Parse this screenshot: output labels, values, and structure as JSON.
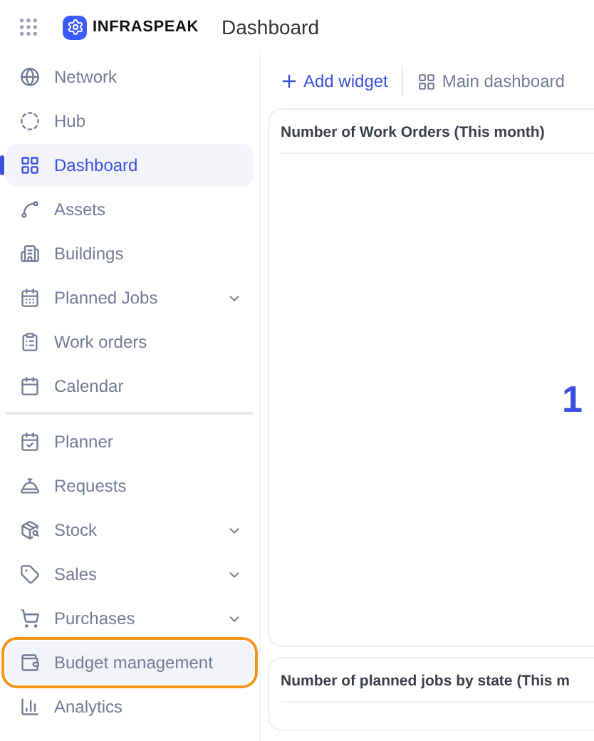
{
  "header": {
    "brand": "INFRASPEAK",
    "title": "Dashboard"
  },
  "sidebar": {
    "groups": [
      [
        {
          "label": "Network",
          "selected": false,
          "has_submenu": false,
          "highlighted": false
        },
        {
          "label": "Hub",
          "selected": false,
          "has_submenu": false,
          "highlighted": false
        },
        {
          "label": "Dashboard",
          "selected": true,
          "has_submenu": false,
          "highlighted": false
        },
        {
          "label": "Assets",
          "selected": false,
          "has_submenu": false,
          "highlighted": false
        },
        {
          "label": "Buildings",
          "selected": false,
          "has_submenu": false,
          "highlighted": false
        },
        {
          "label": "Planned Jobs",
          "selected": false,
          "has_submenu": true,
          "highlighted": false
        },
        {
          "label": "Work orders",
          "selected": false,
          "has_submenu": false,
          "highlighted": false
        },
        {
          "label": "Calendar",
          "selected": false,
          "has_submenu": false,
          "highlighted": false
        }
      ],
      [
        {
          "label": "Planner",
          "selected": false,
          "has_submenu": false,
          "highlighted": false
        },
        {
          "label": "Requests",
          "selected": false,
          "has_submenu": false,
          "highlighted": false
        },
        {
          "label": "Stock",
          "selected": false,
          "has_submenu": true,
          "highlighted": false
        },
        {
          "label": "Sales",
          "selected": false,
          "has_submenu": true,
          "highlighted": false
        },
        {
          "label": "Purchases",
          "selected": false,
          "has_submenu": true,
          "highlighted": false
        },
        {
          "label": "Budget management",
          "selected": false,
          "has_submenu": false,
          "highlighted": true
        },
        {
          "label": "Analytics",
          "selected": false,
          "has_submenu": false,
          "highlighted": false
        }
      ]
    ]
  },
  "toolbar": {
    "add_widget": "Add widget",
    "dashboard_select": "Main dashboard"
  },
  "widgets": [
    {
      "title": "Number of Work Orders (This month)",
      "value": "1"
    },
    {
      "title": "Number of planned jobs by state (This m"
    }
  ]
}
